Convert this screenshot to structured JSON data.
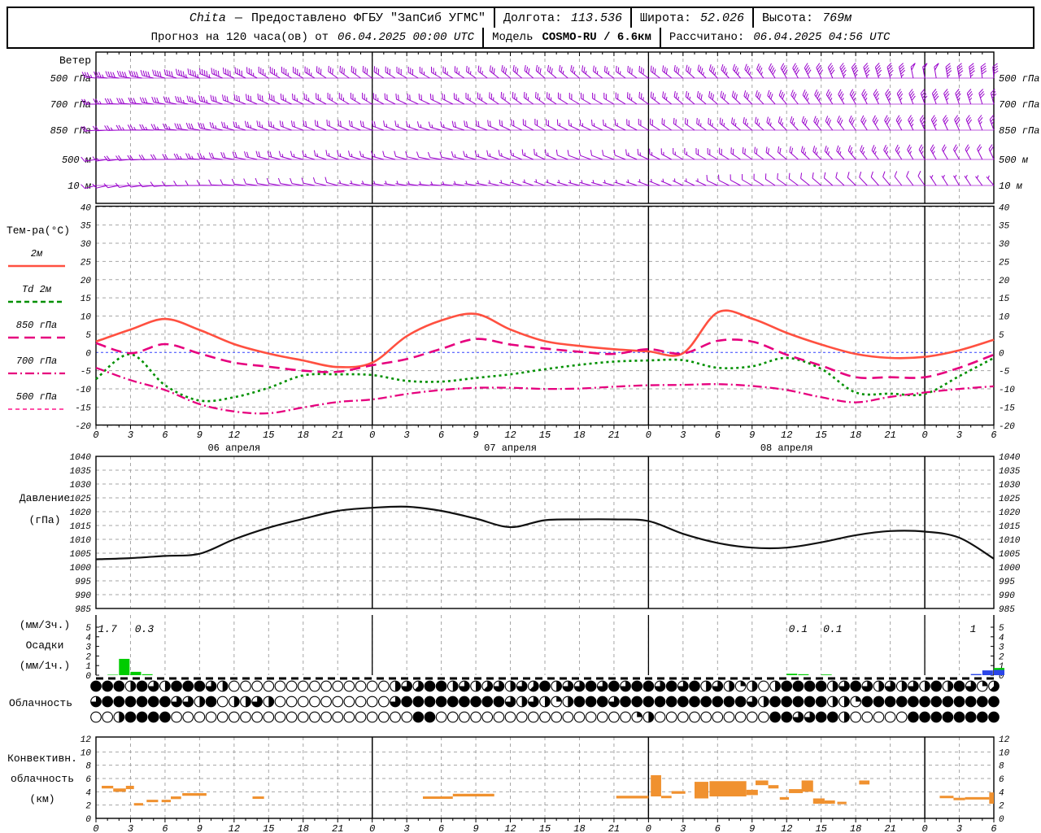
{
  "header": {
    "line1": [
      {
        "v": "Chita",
        "cls": "it"
      },
      {
        "v": "—"
      },
      {
        "v": "Предоставлено ФГБУ \"ЗапСиб УГМС\""
      },
      {
        "v": "|"
      },
      {
        "v": "Долгота:"
      },
      {
        "v": "113.536",
        "cls": "it"
      },
      {
        "v": "|"
      },
      {
        "v": "Широта:"
      },
      {
        "v": "52.026",
        "cls": "it"
      },
      {
        "v": "|"
      },
      {
        "v": "Высота:"
      },
      {
        "v": "769м",
        "cls": "it"
      }
    ],
    "line2": [
      {
        "v": "Прогноз на 120 часа(ов) от"
      },
      {
        "v": "06.04.2025 00:00 UTC",
        "cls": "it"
      },
      {
        "v": "|"
      },
      {
        "v": "Модель"
      },
      {
        "v": "COSMO-RU / 6.6км",
        "cls": "b"
      },
      {
        "v": "|"
      },
      {
        "v": "Рассчитано:"
      },
      {
        "v": "06.04.2025 04:56 UTC",
        "cls": "it"
      }
    ]
  },
  "colors": {
    "barb": "#9900cc",
    "t2m": "#ff5040",
    "td": "#009000",
    "pink": "#e6007e",
    "pink_light": "#ff4fa7",
    "pressure": "#111111",
    "rain": "#00cc00",
    "snow": "#2b46e8",
    "convective": "#f0912f",
    "grid": "#a5a5a5",
    "frame": "#000000",
    "zero_line": "#3344ff"
  },
  "panels": {
    "wind": {
      "title": "Ветер",
      "levels": [
        "500 гПа",
        "700 гПа",
        "850 гПа",
        "500 м",
        "10 м"
      ]
    },
    "temperature": {
      "title": "Тем-ра(°C)"
    },
    "pressure": {
      "title_lines": [
        "Давление",
        "(гПа)"
      ]
    },
    "precipitation": {
      "title_lines": [
        "(мм/3ч.)",
        "Осадки",
        "(мм/1ч.)"
      ]
    },
    "cloudiness": {
      "title": "Облачность"
    },
    "convective": {
      "title_lines": [
        "Конвективн.",
        "облачность",
        "(км)"
      ]
    }
  },
  "chart_data": {
    "type": "meteogram",
    "hours_start": 0,
    "hours_end": 78,
    "sample_step_hours": 3,
    "x_axis": {
      "hour_tick_step": 3,
      "hour_labels_mod": 24,
      "dates": [
        {
          "label": "06 апреля",
          "center_hour": 12
        },
        {
          "label": "07 апреля",
          "center_hour": 36
        },
        {
          "label": "08 апреля",
          "center_hour": 60
        }
      ]
    },
    "wind_barbs": {
      "units": "knots",
      "levels": [
        {
          "label": "500 гПа",
          "dir": [
            275,
            280,
            285,
            290,
            295,
            300,
            300,
            305,
            305,
            300,
            300,
            305,
            310,
            310,
            310,
            305,
            305,
            310,
            315,
            320,
            330,
            335,
            340,
            345,
            350,
            350,
            355
          ],
          "spd": [
            35,
            40,
            40,
            45,
            40,
            35,
            35,
            30,
            30,
            30,
            25,
            25,
            30,
            30,
            25,
            25,
            30,
            30,
            35,
            35,
            40,
            40,
            45,
            45,
            50,
            45,
            40
          ]
        },
        {
          "label": "700 гПа",
          "dir": [
            270,
            275,
            280,
            285,
            290,
            295,
            295,
            300,
            300,
            295,
            295,
            300,
            305,
            305,
            300,
            300,
            305,
            310,
            310,
            315,
            320,
            325,
            330,
            335,
            340,
            340,
            345
          ],
          "spd": [
            25,
            30,
            30,
            35,
            30,
            30,
            25,
            25,
            25,
            20,
            20,
            25,
            25,
            25,
            20,
            20,
            25,
            25,
            30,
            30,
            30,
            35,
            35,
            35,
            40,
            35,
            30
          ]
        },
        {
          "label": "850 гПа",
          "dir": [
            265,
            270,
            275,
            280,
            285,
            290,
            290,
            295,
            290,
            290,
            285,
            290,
            295,
            300,
            295,
            295,
            300,
            305,
            305,
            310,
            315,
            320,
            325,
            330,
            335,
            335,
            340
          ],
          "spd": [
            20,
            25,
            25,
            30,
            25,
            25,
            20,
            20,
            20,
            15,
            15,
            20,
            20,
            20,
            15,
            15,
            20,
            20,
            25,
            25,
            25,
            30,
            30,
            30,
            35,
            30,
            25
          ]
        },
        {
          "label": "500 м",
          "dir": [
            260,
            265,
            270,
            275,
            280,
            285,
            285,
            290,
            285,
            285,
            280,
            285,
            290,
            295,
            290,
            290,
            295,
            300,
            300,
            305,
            310,
            315,
            320,
            325,
            330,
            330,
            335
          ],
          "spd": [
            15,
            20,
            20,
            25,
            20,
            20,
            15,
            15,
            15,
            10,
            10,
            15,
            15,
            15,
            10,
            10,
            15,
            15,
            20,
            20,
            20,
            25,
            25,
            25,
            25,
            20,
            20
          ]
        },
        {
          "label": "10 м",
          "dir": [
            255,
            260,
            265,
            270,
            275,
            280,
            280,
            285,
            280,
            280,
            275,
            280,
            285,
            290,
            285,
            285,
            290,
            295,
            295,
            300,
            305,
            310,
            315,
            320,
            325,
            330,
            320
          ],
          "spd": [
            8,
            10,
            12,
            12,
            10,
            8,
            8,
            8,
            5,
            5,
            3,
            5,
            5,
            5,
            3,
            3,
            5,
            5,
            8,
            8,
            8,
            10,
            10,
            10,
            8,
            5,
            5
          ]
        }
      ]
    },
    "temperature": {
      "ylim": [
        -20,
        40
      ],
      "ytick_step": 5,
      "zero_line": 0,
      "series": [
        {
          "name": "2м",
          "color": "#ff5040",
          "dash": "",
          "width": 2.6,
          "values": [
            3.0,
            6.3,
            9.2,
            6.2,
            2.3,
            -0.3,
            -2.2,
            -4.0,
            -2.8,
            4.5,
            8.8,
            10.6,
            6.3,
            3.1,
            1.8,
            0.9,
            0.3,
            -0.2,
            11.0,
            9.3,
            5.4,
            2.2,
            -0.4,
            -1.5,
            -1.2,
            0.6,
            3.5
          ]
        },
        {
          "name": "Td 2м",
          "color": "#009000",
          "dash": "3 4",
          "width": 2.6,
          "values": [
            -7.3,
            -0.5,
            -9.0,
            -13.2,
            -12.3,
            -9.7,
            -6.3,
            -6.0,
            -6.2,
            -7.8,
            -8.0,
            -7.0,
            -6.0,
            -4.6,
            -3.4,
            -2.5,
            -2.2,
            -2.1,
            -4.2,
            -3.8,
            -1.5,
            -4.5,
            -11.0,
            -11.3,
            -11.4,
            -6.5,
            -1.5
          ]
        },
        {
          "name": "850 гПа",
          "color": "#e6007e",
          "dash": "13 7",
          "width": 2.6,
          "values": [
            2.6,
            -0.2,
            2.3,
            -0.3,
            -2.8,
            -3.9,
            -5.0,
            -5.3,
            -3.5,
            -1.8,
            1.0,
            3.7,
            2.2,
            1.1,
            0.2,
            -0.4,
            0.9,
            -0.3,
            3.2,
            3.0,
            -0.6,
            -3.6,
            -6.8,
            -6.8,
            -6.8,
            -4.2,
            -0.6
          ]
        },
        {
          "name": "700 гПа",
          "color": "#e6007e",
          "dash": "11 4 2 4",
          "width": 2.3,
          "values": [
            -4.2,
            -7.6,
            -10.3,
            -14.2,
            -16.2,
            -16.7,
            -15.1,
            -13.6,
            -12.9,
            -11.4,
            -10.3,
            -9.7,
            -9.7,
            -10.0,
            -9.9,
            -9.4,
            -9.0,
            -8.9,
            -8.7,
            -9.2,
            -10.3,
            -12.3,
            -13.7,
            -12.2,
            -11.0,
            -10.0,
            -9.3
          ]
        },
        {
          "name": "500 гПа",
          "color": "#ff4fa7",
          "dash": "5 4",
          "width": 2,
          "visible": false,
          "values": []
        }
      ]
    },
    "pressure": {
      "ylim": [
        985,
        1040
      ],
      "ytick_step": 5,
      "values": [
        1002.8,
        1003.2,
        1004.0,
        1004.8,
        1010.0,
        1014.2,
        1017.4,
        1020.3,
        1021.4,
        1021.8,
        1020.3,
        1017.5,
        1014.4,
        1016.9,
        1017.2,
        1017.2,
        1016.6,
        1012.0,
        1008.7,
        1007.0,
        1007.0,
        1008.9,
        1011.5,
        1013.0,
        1012.8,
        1010.6,
        1003.0
      ]
    },
    "precipitation": {
      "ylim": [
        0,
        6
      ],
      "yticks": [
        0,
        1,
        2,
        3,
        4,
        5
      ],
      "bars": [
        {
          "h": 1,
          "rain": 0.05
        },
        {
          "h": 2,
          "rain": 1.7
        },
        {
          "h": 3,
          "rain": 0.35
        },
        {
          "h": 4,
          "rain": 0.1
        },
        {
          "h": 60,
          "rain": 0.15
        },
        {
          "h": 61,
          "rain": 0.1
        },
        {
          "h": 63,
          "rain": 0.07
        },
        {
          "h": 76,
          "snow": 0.12
        },
        {
          "h": 77,
          "snow": 0.5
        },
        {
          "h": 78,
          "snow": 0.55,
          "rain": 0.2
        }
      ],
      "annotations_3h": [
        {
          "h": 1,
          "t": "1.7"
        },
        {
          "h": 4.2,
          "t": "0.3"
        },
        {
          "h": 61,
          "t": "0.1"
        },
        {
          "h": 64,
          "t": "0.1"
        },
        {
          "h": 76.2,
          "t": "1"
        }
      ]
    },
    "cloud_rows_eighths": [
      "8884864888640000000000000046588464564658466868688686846424048888468646464848625",
      "6888888664804464000000000068888888886464248886888888888886488888442888888888888",
      "0048888000000000000000000000880000000000000000024000000000088668840000088888888"
    ],
    "convective": {
      "ylim": [
        0,
        12
      ],
      "ytick_step": 2,
      "segments": [
        [
          0.5,
          1.5,
          4.5,
          4.9
        ],
        [
          1.5,
          2.6,
          4.0,
          4.5
        ],
        [
          2.6,
          3.3,
          4.4,
          4.9
        ],
        [
          3.3,
          4.1,
          2.0,
          2.3
        ],
        [
          4.4,
          5.4,
          2.5,
          2.8
        ],
        [
          5.7,
          6.5,
          2.5,
          2.8
        ],
        [
          6.5,
          7.4,
          2.9,
          3.3
        ],
        [
          7.5,
          9.6,
          3.4,
          3.8
        ],
        [
          13.6,
          14.6,
          3.0,
          3.3
        ],
        [
          28.4,
          31.0,
          3.0,
          3.3
        ],
        [
          31.0,
          34.6,
          3.3,
          3.7
        ],
        [
          45.2,
          48.0,
          3.0,
          3.4
        ],
        [
          48.2,
          49.1,
          3.3,
          6.5
        ],
        [
          49.1,
          50.0,
          3.1,
          3.4
        ],
        [
          50.0,
          51.2,
          3.7,
          4.1
        ],
        [
          52.0,
          53.2,
          3.0,
          5.5
        ],
        [
          53.3,
          56.5,
          3.3,
          5.6
        ],
        [
          56.5,
          57.5,
          3.5,
          4.3
        ],
        [
          57.3,
          58.4,
          5.0,
          5.7
        ],
        [
          58.4,
          59.3,
          4.5,
          5.0
        ],
        [
          59.4,
          60.2,
          2.8,
          3.2
        ],
        [
          60.2,
          61.4,
          3.8,
          4.4
        ],
        [
          61.3,
          62.3,
          4.0,
          5.7
        ],
        [
          62.3,
          63.3,
          2.2,
          3.0
        ],
        [
          63.3,
          64.2,
          2.2,
          2.7
        ],
        [
          64.4,
          65.2,
          2.2,
          2.5
        ],
        [
          66.3,
          67.2,
          5.1,
          5.7
        ],
        [
          73.3,
          74.5,
          3.1,
          3.4
        ],
        [
          74.5,
          75.5,
          2.8,
          3.1
        ],
        [
          75.5,
          77.6,
          2.9,
          3.2
        ],
        [
          77.6,
          78.0,
          2.2,
          3.9
        ]
      ]
    }
  }
}
